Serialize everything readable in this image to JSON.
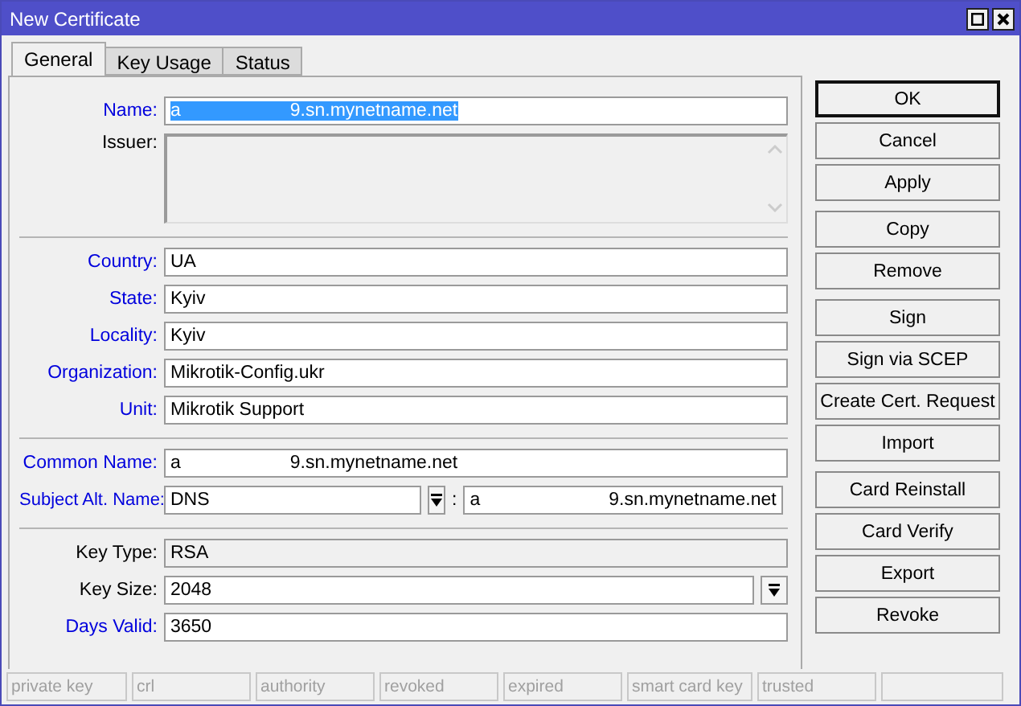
{
  "window": {
    "title": "New Certificate"
  },
  "tabs": [
    {
      "label": "General",
      "selected": true
    },
    {
      "label": "Key Usage",
      "selected": false
    },
    {
      "label": "Status",
      "selected": false
    }
  ],
  "sections": [
    {
      "rows": [
        {
          "kind": "name",
          "label": "Name:",
          "emphasis": true,
          "value_start": "a",
          "value_end": "9.sn.mynetname.net",
          "highlighted": true
        },
        {
          "kind": "area",
          "label": "Issuer:",
          "emphasis": false,
          "disabled": true
        }
      ]
    },
    {
      "rows": [
        {
          "kind": "text",
          "label": "Country:",
          "emphasis": true,
          "value": "UA",
          "disabled": false
        },
        {
          "kind": "text",
          "label": "State:",
          "emphasis": true,
          "value": "Kyiv",
          "disabled": false
        },
        {
          "kind": "text",
          "label": "Locality:",
          "emphasis": true,
          "value": "Kyiv",
          "disabled": false
        },
        {
          "kind": "text",
          "label": "Organization:",
          "emphasis": true,
          "value": "Mikrotik-Config.ukr",
          "disabled": false
        },
        {
          "kind": "text",
          "label": "Unit:",
          "emphasis": true,
          "value": "Mikrotik Support",
          "disabled": false
        }
      ]
    },
    {
      "rows": [
        {
          "kind": "name",
          "label": "Common Name:",
          "emphasis": true,
          "value_start": "a",
          "value_end": "9.sn.mynetname.net",
          "highlighted": false
        },
        {
          "kind": "san",
          "label": "Subject Alt. Name:",
          "emphasis": true,
          "value": "DNS",
          "separator": ":",
          "value2_start": "a",
          "value2_end": "9.sn.mynetname.net"
        }
      ]
    },
    {
      "rows": [
        {
          "kind": "text",
          "label": "Key Type:",
          "emphasis": false,
          "value": "RSA",
          "disabled": true
        },
        {
          "kind": "dropdown",
          "label": "Key Size:",
          "emphasis": false,
          "value": "2048"
        },
        {
          "kind": "text",
          "label": "Days Valid:",
          "emphasis": true,
          "value": "3650",
          "disabled": false
        }
      ]
    }
  ],
  "button_groups": [
    [
      {
        "label": "OK",
        "default": true
      },
      {
        "label": "Cancel",
        "default": false
      },
      {
        "label": "Apply",
        "default": false
      }
    ],
    [
      {
        "label": "Copy",
        "default": false
      },
      {
        "label": "Remove",
        "default": false
      }
    ],
    [
      {
        "label": "Sign",
        "default": false
      },
      {
        "label": "Sign via SCEP",
        "default": false
      },
      {
        "label": "Create Cert. Request",
        "default": false
      },
      {
        "label": "Import",
        "default": false
      }
    ],
    [
      {
        "label": "Card Reinstall",
        "default": false
      },
      {
        "label": "Card Verify",
        "default": false
      },
      {
        "label": "Export",
        "default": false
      },
      {
        "label": "Revoke",
        "default": false
      }
    ]
  ],
  "status_bar": [
    "private key",
    "crl",
    "authority",
    "revoked",
    "expired",
    "smart card key",
    "trusted"
  ]
}
